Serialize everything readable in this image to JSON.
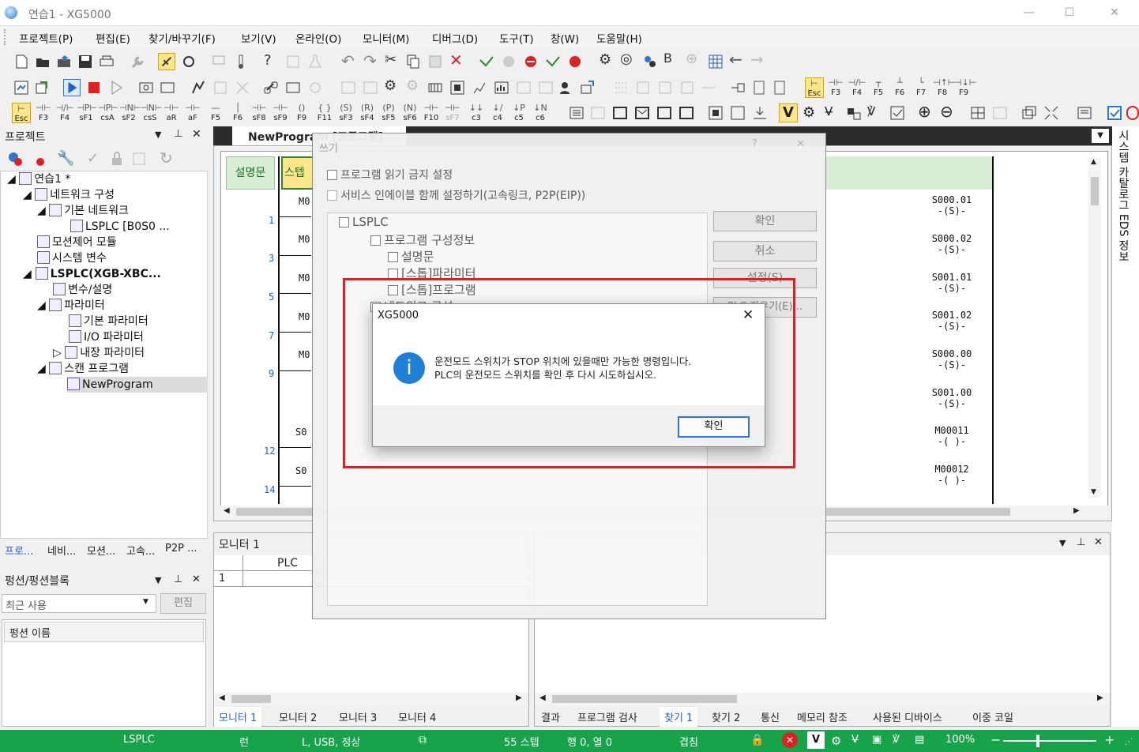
{
  "window": {
    "title": "연습1 - XG5000"
  },
  "menu": [
    "프로젝트(P)",
    "편집(E)",
    "찾기/바꾸기(F)",
    "보기(V)",
    "온라인(O)",
    "모니터(M)",
    "디버그(D)",
    "도구(T)",
    "창(W)",
    "도움말(H)"
  ],
  "fkeys_row3": [
    "Esc",
    "F3",
    "F4",
    "sF1",
    "csA",
    "sF2",
    "csS",
    "aR",
    "aF",
    "F5",
    "F6",
    "sF8",
    "sF9",
    "F9",
    "F11",
    "sF3",
    "sF4",
    "sF5",
    "sF6",
    "F10",
    "sF7",
    "c3",
    "c4",
    "c5",
    "c6"
  ],
  "fkeys_row2": [
    "Esc",
    "F3",
    "F4",
    "F5",
    "F6",
    "F7",
    "F8",
    "F9"
  ],
  "project_panel": {
    "title": "프로젝트",
    "tree": [
      "연습1 *",
      "네트워크 구성",
      "기본 네트워크",
      "LSPLC [B0S0 ...",
      "모션제어 모듈",
      "시스템 변수",
      "LSPLC(XGB-XBC...",
      "변수/설명",
      "파라미터",
      "기본 파라미터",
      "I/O 파라미터",
      "내장 파라미터",
      "스캔 프로그램",
      "NewProgram"
    ],
    "tabs": [
      "프로...",
      "네비...",
      "모션...",
      "고속...",
      "P2P ..."
    ]
  },
  "function_panel": {
    "title": "펑션/펑션블록",
    "combo": "최근 사용",
    "edit_btn": "편집",
    "col": "펑션 이름"
  },
  "editor": {
    "tab": "NewProgram [프로그램]",
    "col_desc": "설명문",
    "col_step": "스텝",
    "rung_numbers": [
      "1",
      "3",
      "5",
      "7",
      "9",
      "12",
      "14"
    ],
    "contacts": [
      "M0",
      "M0",
      "M0",
      "M0",
      "M0",
      "S0",
      "S0"
    ],
    "coils": [
      {
        "addr": "S000.01",
        "sym": "-(S)-"
      },
      {
        "addr": "S000.02",
        "sym": "-(S)-"
      },
      {
        "addr": "S001.01",
        "sym": "-(S)-"
      },
      {
        "addr": "S001.02",
        "sym": "-(S)-"
      },
      {
        "addr": "S000.00",
        "sym": "-(S)-"
      },
      {
        "addr": "S001.00",
        "sym": "-(S)-"
      },
      {
        "addr": "M00011",
        "sym": "-( )-"
      },
      {
        "addr": "M00012",
        "sym": "-( )-"
      }
    ]
  },
  "side_tabs": {
    "text": "시스템 카탈로그  EDS 정보"
  },
  "monitor_panel": {
    "title": "모니터 1",
    "col_plc": "PLC",
    "row1": "1",
    "tabs": [
      "모니터 1",
      "모니터 2",
      "모니터 3",
      "모니터 4"
    ]
  },
  "result_panel": {
    "tabs": [
      "결과",
      "프로그램 검사",
      "찾기 1",
      "찾기 2",
      "통신",
      "메모리 참조",
      "사용된 디바이스",
      "이중 코일"
    ]
  },
  "write_dialog": {
    "title": "쓰기",
    "help": "?",
    "close": "✕",
    "chk1": "프로그램 읽기 금지 설정",
    "chk2": "서비스 인에이블 함께 설정하기(고속링크, P2P(EIP))",
    "tree": [
      "LSPLC",
      "프로그램 구성정보",
      "설명문",
      "[스톱]파라미터",
      "[스톱]프로그램",
      "네트워크 구성"
    ],
    "buttons": [
      "확인",
      "취소",
      "설정(S)",
      "PLC 지우기(E)..."
    ]
  },
  "msgbox": {
    "title": "XG5000",
    "close": "✕",
    "icon": "i",
    "line1": "운전모드 스위치가 STOP 위치에 있을때만 가능한 명령입니다.",
    "line2": "PLC의 운전모드 스위치를 확인 후 다시 시도하십시오.",
    "ok": "확인"
  },
  "status": {
    "plc": "LSPLC",
    "mode": "런",
    "conn": "L, USB, 정상",
    "steps": "55 스텝",
    "pos": "행 0, 열 0",
    "ovr": "겹침",
    "zoom": "100%",
    "minus": "−",
    "plus": "+"
  },
  "colors": {
    "status_green": "#16a34a",
    "highlight_red": "#e02020",
    "info_blue": "#1f7fd6"
  }
}
